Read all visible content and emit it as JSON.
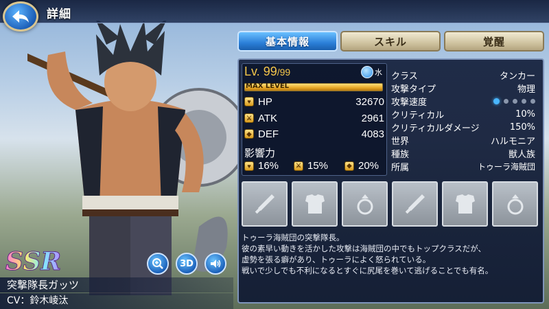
{
  "header": {
    "title": "詳細",
    "back_icon": "back-arrow-icon"
  },
  "tabs": [
    {
      "label": "基本情報",
      "active": true
    },
    {
      "label": "スキル",
      "active": false
    },
    {
      "label": "覚醒",
      "active": false
    }
  ],
  "level": {
    "prefix": "Lv.",
    "current": "99",
    "max": "/99",
    "bar_label": "MAX LEVEL",
    "progress": 1.0
  },
  "element": {
    "label": "水",
    "icon": "water-drop-icon",
    "color": "#2d8ee8"
  },
  "stats": [
    {
      "name": "HP",
      "value": "32670",
      "icon": "heart-icon"
    },
    {
      "name": "ATK",
      "value": "2961",
      "icon": "sword-icon"
    },
    {
      "name": "DEF",
      "value": "4083",
      "icon": "shield-icon"
    }
  ],
  "influence": {
    "label": "影響力",
    "items": [
      {
        "value": "16%",
        "icon": "heart-icon"
      },
      {
        "value": "15%",
        "icon": "sword-icon"
      },
      {
        "value": "20%",
        "icon": "shield-icon"
      }
    ]
  },
  "info": [
    {
      "key": "クラス",
      "value": "タンカー"
    },
    {
      "key": "攻撃タイプ",
      "value": "物理"
    },
    {
      "key": "攻撃速度",
      "value": "",
      "speed_level": 1,
      "speed_max": 5
    },
    {
      "key": "クリティカル",
      "value": "10%"
    },
    {
      "key": "クリティカルダメージ",
      "value": "150%"
    },
    {
      "key": "世界",
      "value": "ハルモニア"
    },
    {
      "key": "種族",
      "value": "獣人族"
    },
    {
      "key": "所属",
      "value": "トゥーラ海賊団"
    }
  ],
  "equipment": [
    {
      "slot": "weapon",
      "icon": "sword-icon"
    },
    {
      "slot": "armor",
      "icon": "armor-icon"
    },
    {
      "slot": "accessory",
      "icon": "ring-icon"
    },
    {
      "slot": "weapon",
      "icon": "sword-icon"
    },
    {
      "slot": "armor",
      "icon": "armor-icon"
    },
    {
      "slot": "accessory",
      "icon": "ring-icon"
    }
  ],
  "description": [
    "トゥーラ海賊団の突撃隊長。",
    "彼の素早い動きを活かした攻撃は海賊団の中でもトップクラスだが、",
    "虚勢を張る癖があり、トゥーラによく怒られている。",
    "戦いで少しでも不利になるとすぐに尻尾を巻いて逃げることでも有名。"
  ],
  "rarity": "SSR",
  "controls": {
    "zoom_icon": "zoom-in-icon",
    "view3d_label": "3D",
    "voice_icon": "speaker-icon"
  },
  "character": {
    "name": "突撃隊長ガッツ",
    "cv": "CV：鈴木崚汰"
  }
}
